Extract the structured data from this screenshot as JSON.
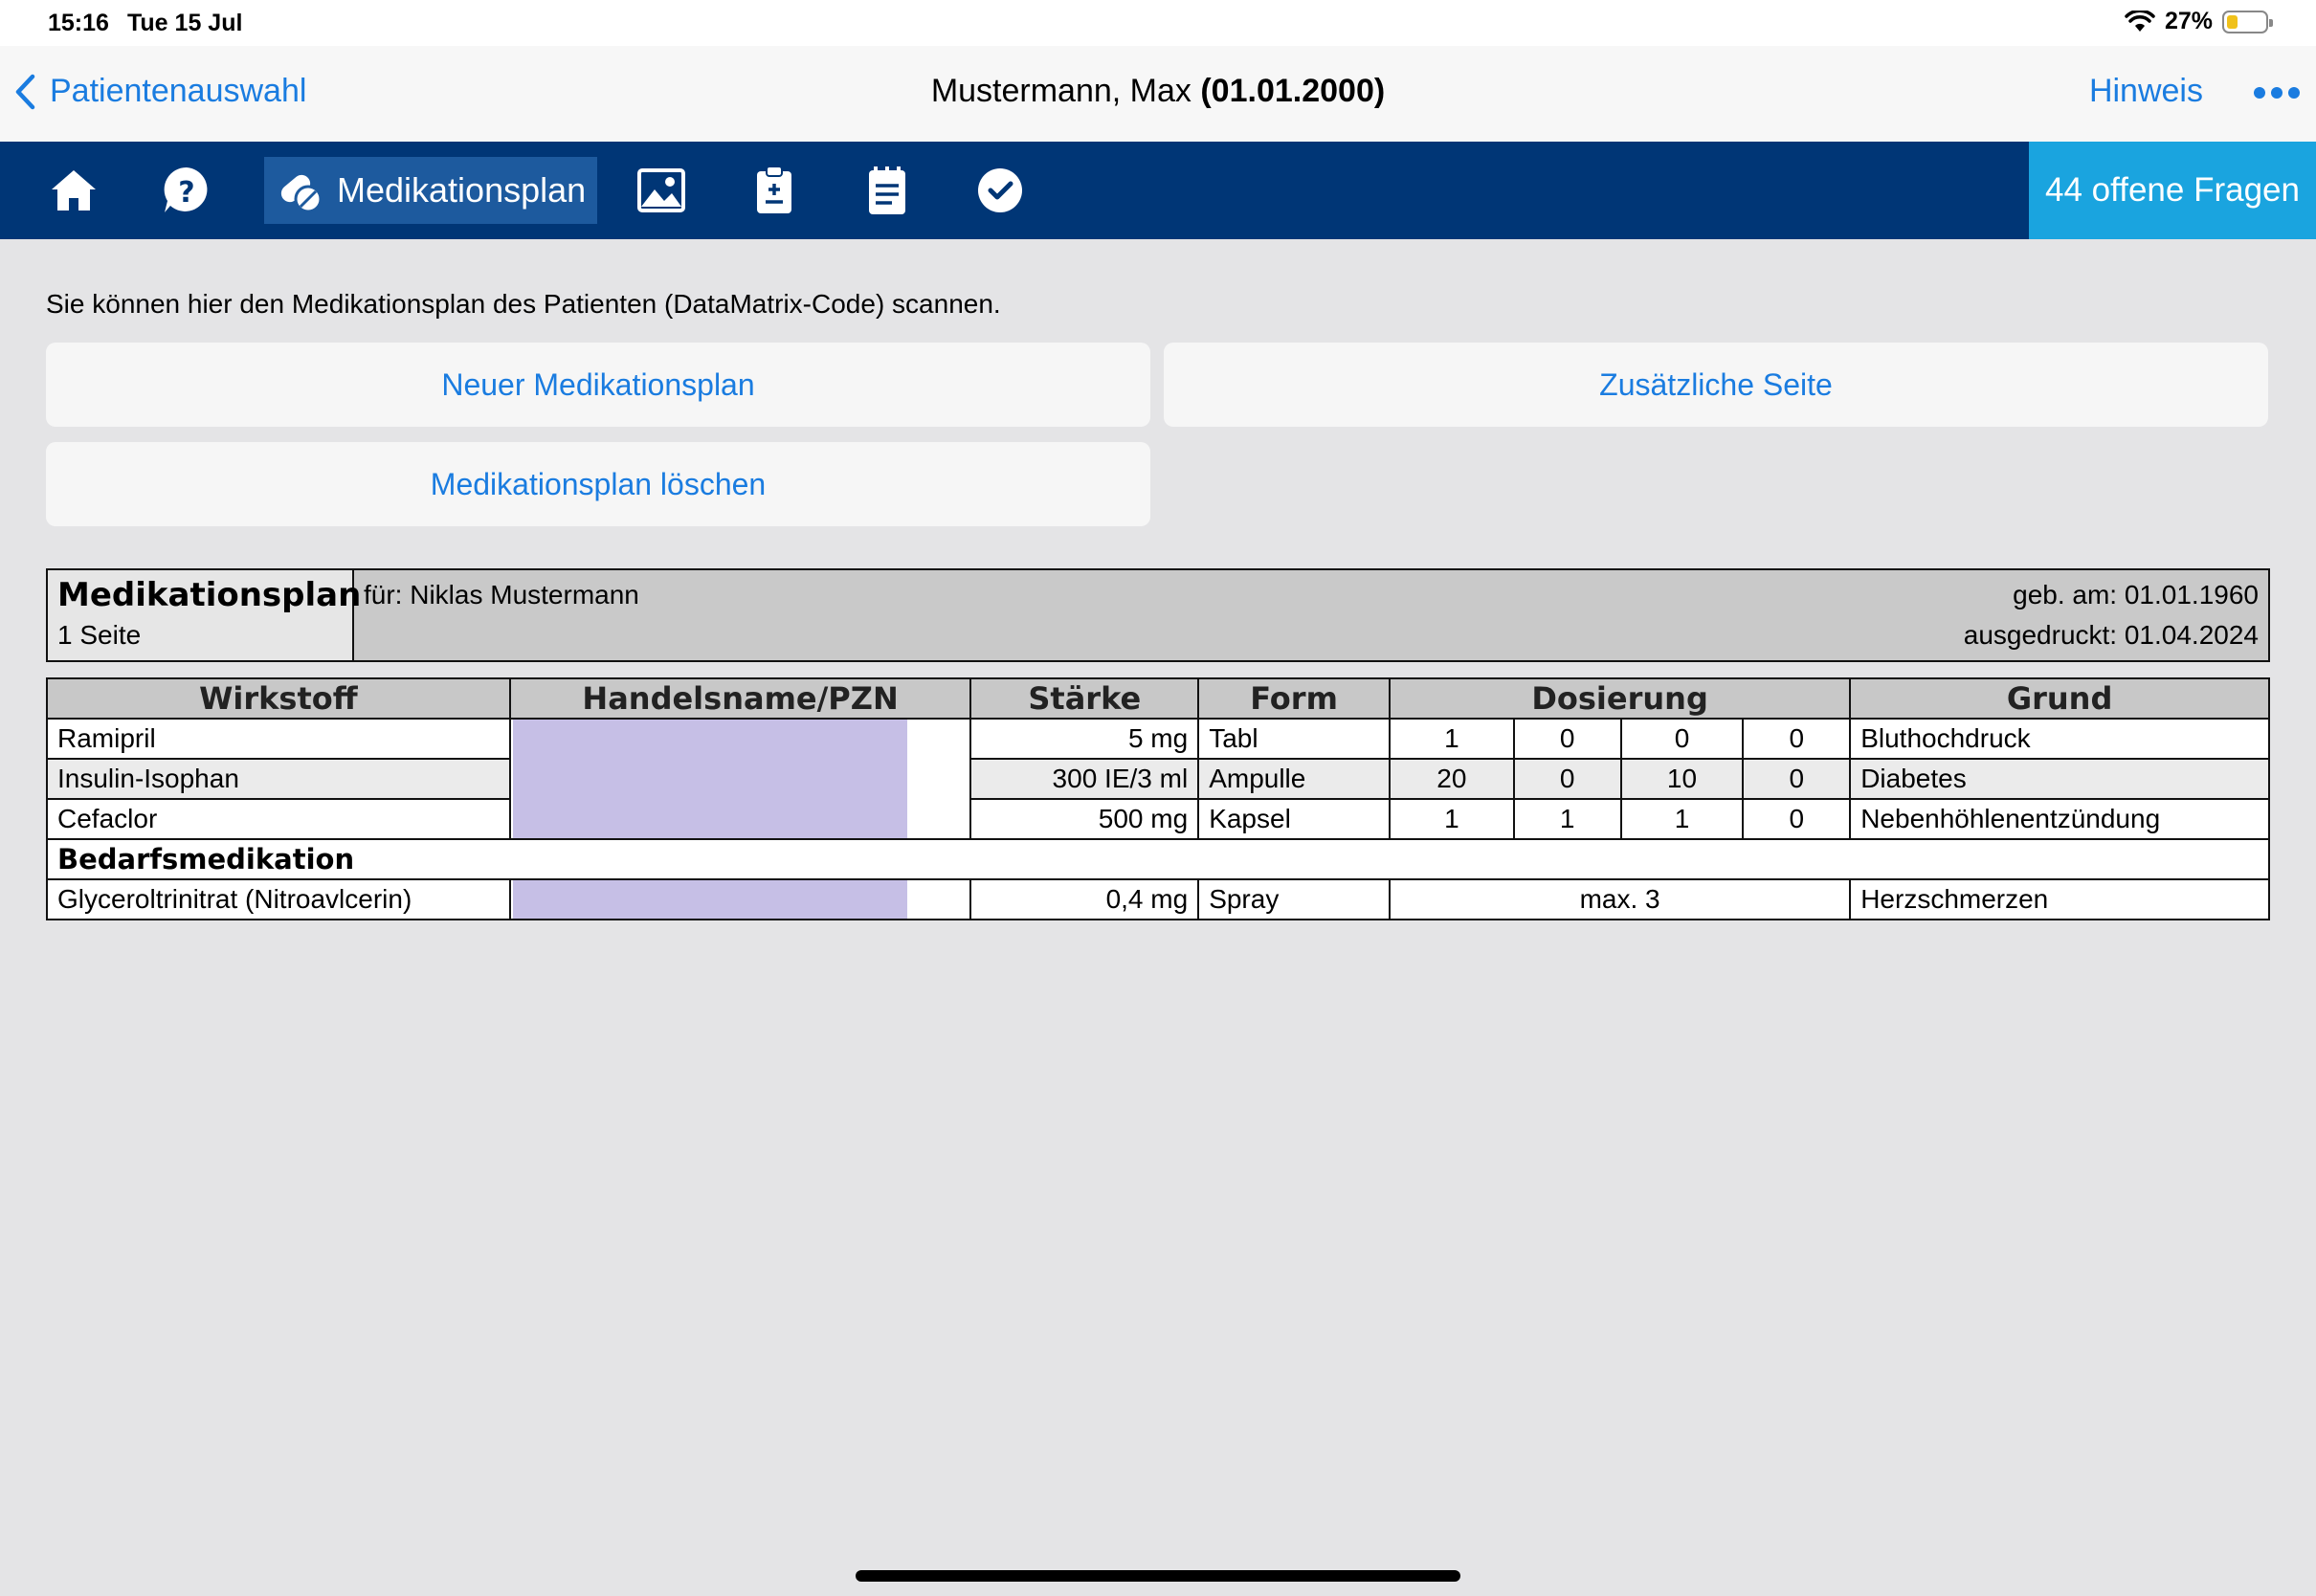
{
  "statusbar": {
    "time": "15:16",
    "date": "Tue 15 Jul",
    "battery": "27%"
  },
  "nav": {
    "back_label": "Patientenauswahl",
    "title_name": "Mustermann, Max",
    "title_dob": "(01.01.2000)",
    "hint_label": "Hinweis"
  },
  "toolbar": {
    "active_label": "Medikationsplan",
    "open_questions": "44 offene Fragen",
    "icons": [
      "home-icon",
      "help-icon",
      "pills-icon",
      "image-icon",
      "clipboard-icon",
      "notepad-icon",
      "check-icon"
    ]
  },
  "content": {
    "intro": "Sie können hier den Medikationsplan des Patienten (DataMatrix-Code) scannen.",
    "btn_new": "Neuer Medikationsplan",
    "btn_extra": "Zusätzliche Seite",
    "btn_delete": "Medikationsplan löschen"
  },
  "plan": {
    "title": "Medikationsplan",
    "pages": "1 Seite",
    "for": "für: Niklas Mustermann",
    "born": "geb. am: 01.01.1960",
    "printed": "ausgedruckt: 01.04.2024"
  },
  "table": {
    "headers": {
      "agent": "Wirkstoff",
      "trade": "Handelsname/PZN",
      "strength": "Stärke",
      "form": "Form",
      "dosage": "Dosierung",
      "reason": "Grund"
    },
    "rows": [
      {
        "agent": "Ramipril",
        "strength": "5 mg",
        "form": "Tabl",
        "d1": "1",
        "d2": "0",
        "d3": "0",
        "d4": "0",
        "reason": "Bluthochdruck"
      },
      {
        "agent": "Insulin-Isophan",
        "strength": "300 IE/3 ml",
        "form": "Ampulle",
        "d1": "20",
        "d2": "0",
        "d3": "10",
        "d4": "0",
        "reason": "Diabetes"
      },
      {
        "agent": "Cefaclor",
        "strength": "500 mg",
        "form": "Kapsel",
        "d1": "1",
        "d2": "1",
        "d3": "1",
        "d4": "0",
        "reason": "Nebenhöhlenentzündung"
      }
    ],
    "section": "Bedarfsmedikation",
    "prn": {
      "agent": "Glyceroltrinitrat (Nitroavlcerin)",
      "strength": "0,4 mg",
      "form": "Spray",
      "dosage": "max. 3",
      "reason": "Herzschmerzen"
    }
  },
  "colors": {
    "brand": "#003676",
    "accent": "#1a7ce0",
    "open_questions_bg": "#1aa4df",
    "redaction": "#c6bfe6"
  }
}
